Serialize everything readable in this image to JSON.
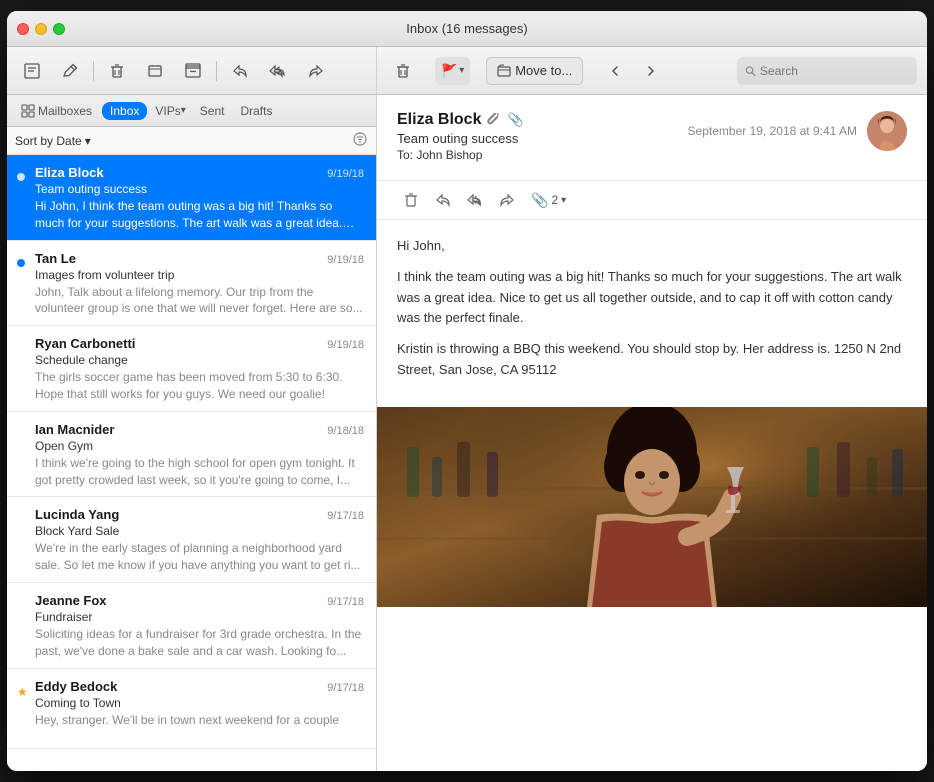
{
  "window": {
    "title": "Inbox (16 messages)"
  },
  "toolbar_left": {
    "compose_label": "✏️",
    "delete_label": "🗑",
    "junk_label": "⚠",
    "archive_label": "📁",
    "reply_label": "↩",
    "reply_all_label": "↩↩",
    "forward_label": "→"
  },
  "tabs": {
    "mailboxes_label": "Mailboxes",
    "inbox_label": "Inbox",
    "vips_label": "VIPs",
    "sent_label": "Sent",
    "drafts_label": "Drafts"
  },
  "sort_bar": {
    "label": "Sort by Date",
    "chevron": "▾"
  },
  "emails": [
    {
      "id": 1,
      "sender": "Eliza Block",
      "subject": "Team outing success",
      "preview": "Hi John, I think the team outing was a big hit! Thanks so much for your suggestions. The art walk was a great idea. N...",
      "date": "9/19/18",
      "unread": true,
      "selected": true,
      "star": false,
      "attachment": false
    },
    {
      "id": 2,
      "sender": "Tan Le",
      "subject": "Images from volunteer trip",
      "preview": "John, Talk about a lifelong memory. Our trip from the volunteer group is one that we will never forget. Here are so...",
      "date": "9/19/18",
      "unread": false,
      "selected": false,
      "star": false,
      "attachment": false
    },
    {
      "id": 3,
      "sender": "Ryan Carbonetti",
      "subject": "Schedule change",
      "preview": "The girls soccer game has been moved from 5:30 to 6:30. Hope that still works for you guys. We need our goalie!",
      "date": "9/19/18",
      "unread": false,
      "selected": false,
      "star": false,
      "attachment": false
    },
    {
      "id": 4,
      "sender": "Ian Macnider",
      "subject": "Open Gym",
      "preview": "I think we're going to the high school for open gym tonight. It got pretty crowded last week, so it you're going to come, I...",
      "date": "9/18/18",
      "unread": false,
      "selected": false,
      "star": false,
      "attachment": false
    },
    {
      "id": 5,
      "sender": "Lucinda Yang",
      "subject": "Block Yard Sale",
      "preview": "We're in the early stages of planning a neighborhood yard sale. So let me know if you have anything you want to get ri...",
      "date": "9/17/18",
      "unread": false,
      "selected": false,
      "star": false,
      "attachment": false
    },
    {
      "id": 6,
      "sender": "Jeanne Fox",
      "subject": "Fundraiser",
      "preview": "Soliciting ideas for a fundraiser for 3rd grade orchestra. In the past, we've done a bake sale and a car wash. Looking fo...",
      "date": "9/17/18",
      "unread": false,
      "selected": false,
      "star": false,
      "attachment": false
    },
    {
      "id": 7,
      "sender": "Eddy Bedock",
      "subject": "Coming to Town",
      "preview": "Hey, stranger. We'll be in town next weekend for a couple",
      "date": "9/17/18",
      "unread": false,
      "selected": false,
      "star": true,
      "attachment": false
    }
  ],
  "detail": {
    "from_name": "Eliza Block",
    "has_attachment": true,
    "timestamp": "September 19, 2018 at 9:41 AM",
    "subject": "Team outing success",
    "to_label": "To:",
    "to_name": "John Bishop",
    "body_lines": [
      "Hi John,",
      "I think the team outing was a big hit! Thanks so much for your suggestions. The art walk was a great idea. Nice to get us all together outside, and to cap it off with cotton candy was the perfect finale.",
      "Kristin is throwing a BBQ this weekend. You should stop by. Her address is. 1250 N 2nd Street, San Jose, CA 95112"
    ],
    "attachment_count": "2",
    "action_buttons": {
      "trash": "🗑",
      "reply": "↩",
      "reply_all": "↩↩",
      "forward": "→",
      "attachments": "📎 2 ▾"
    }
  },
  "right_toolbar": {
    "trash_label": "🗑",
    "flag_label": "🚩",
    "flag_chevron": "▾",
    "move_to_icon": "📁",
    "move_to_label": "Move to...",
    "search_placeholder": "Search",
    "nav_left": "←",
    "nav_right": "→"
  }
}
